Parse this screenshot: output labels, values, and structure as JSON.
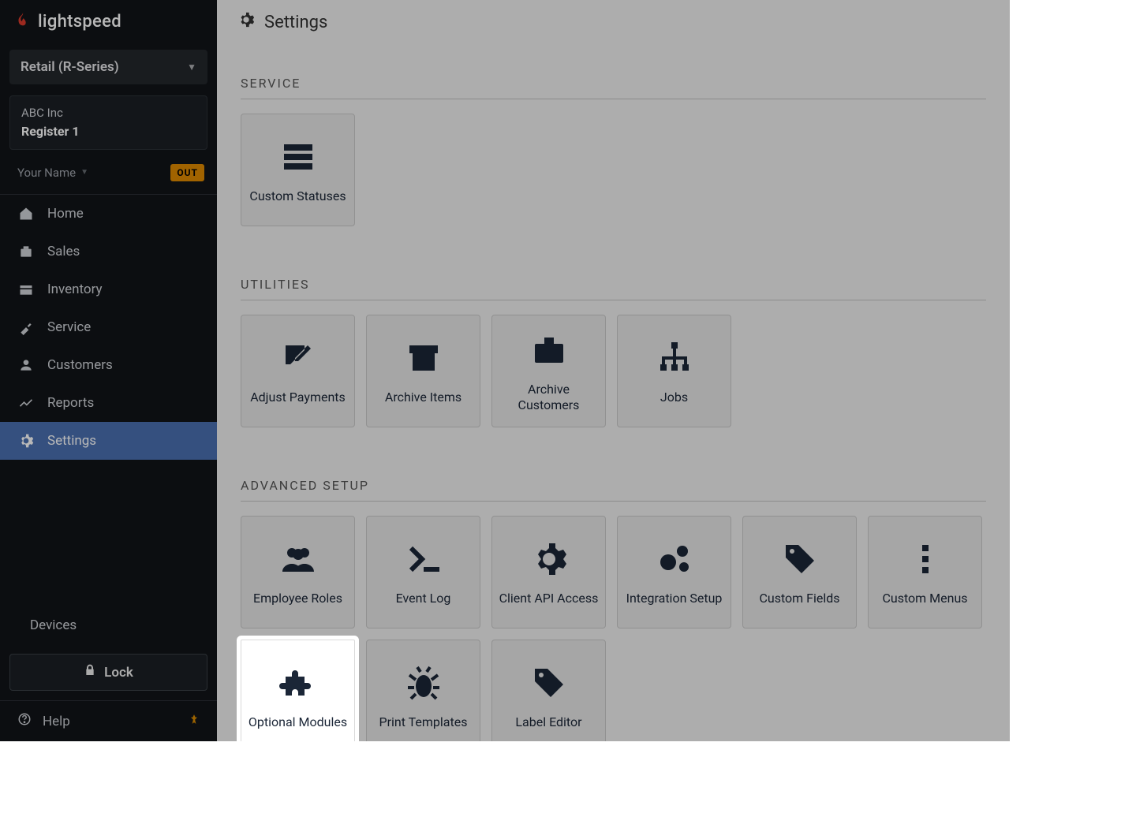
{
  "brand": "lightspeed",
  "product_selector": {
    "label": "Retail (R-Series)"
  },
  "company": {
    "name": "ABC Inc",
    "register": "Register 1"
  },
  "user": {
    "name": "Your Name",
    "status_badge": "OUT"
  },
  "nav": {
    "items": [
      {
        "id": "home",
        "label": "Home",
        "icon": "home-icon"
      },
      {
        "id": "sales",
        "label": "Sales",
        "icon": "sales-icon"
      },
      {
        "id": "inventory",
        "label": "Inventory",
        "icon": "inventory-icon"
      },
      {
        "id": "service",
        "label": "Service",
        "icon": "service-icon"
      },
      {
        "id": "customers",
        "label": "Customers",
        "icon": "customers-icon"
      },
      {
        "id": "reports",
        "label": "Reports",
        "icon": "reports-icon"
      },
      {
        "id": "settings",
        "label": "Settings",
        "icon": "settings-icon",
        "active": true
      }
    ],
    "devices": "Devices",
    "lock": "Lock",
    "help": "Help"
  },
  "page": {
    "title": "Settings",
    "sections": [
      {
        "id": "service",
        "title": "SERVICE",
        "tiles": [
          {
            "id": "custom-statuses",
            "label": "Custom Statuses",
            "icon": "list-icon"
          }
        ]
      },
      {
        "id": "utilities",
        "title": "UTILITIES",
        "tiles": [
          {
            "id": "adjust-payments",
            "label": "Adjust Payments",
            "icon": "edit-square-icon"
          },
          {
            "id": "archive-items",
            "label": "Archive Items",
            "icon": "archive-box-icon"
          },
          {
            "id": "archive-customers",
            "label": "Archive Customers",
            "icon": "briefcase-icon"
          },
          {
            "id": "jobs",
            "label": "Jobs",
            "icon": "sitemap-icon"
          }
        ]
      },
      {
        "id": "advanced-setup",
        "title": "ADVANCED SETUP",
        "tiles": [
          {
            "id": "employee-roles",
            "label": "Employee Roles",
            "icon": "users-icon"
          },
          {
            "id": "event-log",
            "label": "Event Log",
            "icon": "terminal-icon"
          },
          {
            "id": "client-api-access",
            "label": "Client API Access",
            "icon": "gear-icon"
          },
          {
            "id": "integration-setup",
            "label": "Integration Setup",
            "icon": "gears-icon"
          },
          {
            "id": "custom-fields",
            "label": "Custom Fields",
            "icon": "tags-icon"
          },
          {
            "id": "custom-menus",
            "label": "Custom Menus",
            "icon": "dots-vertical-icon"
          },
          {
            "id": "optional-modules",
            "label": "Optional Modules",
            "icon": "puzzle-icon",
            "highlighted": true
          },
          {
            "id": "print-templates",
            "label": "Print Templates",
            "icon": "bug-icon"
          },
          {
            "id": "label-editor",
            "label": "Label Editor",
            "icon": "tag-icon"
          }
        ]
      }
    ]
  }
}
